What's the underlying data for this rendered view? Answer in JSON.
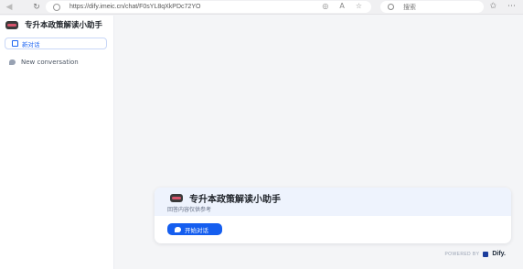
{
  "browser": {
    "url": "https://dify.imeic.cn/chat/F0sYL8qXkPDc72YO",
    "search_placeholder": "搜索"
  },
  "app": {
    "title": "专升本政策解读小助手",
    "subtitle": "回答内容仅供参考"
  },
  "sidebar": {
    "new_chat_label": "新对话",
    "conversations": [
      {
        "label": "New conversation"
      }
    ]
  },
  "welcome": {
    "start_label": "开始对话"
  },
  "footer": {
    "powered_by": "POWERED BY",
    "brand": "Dify."
  },
  "colors": {
    "accent": "#155eef",
    "sidebar_bg": "#ffffff",
    "page_bg": "#f4f5f7",
    "card_head_bg": "#eef3fd"
  }
}
